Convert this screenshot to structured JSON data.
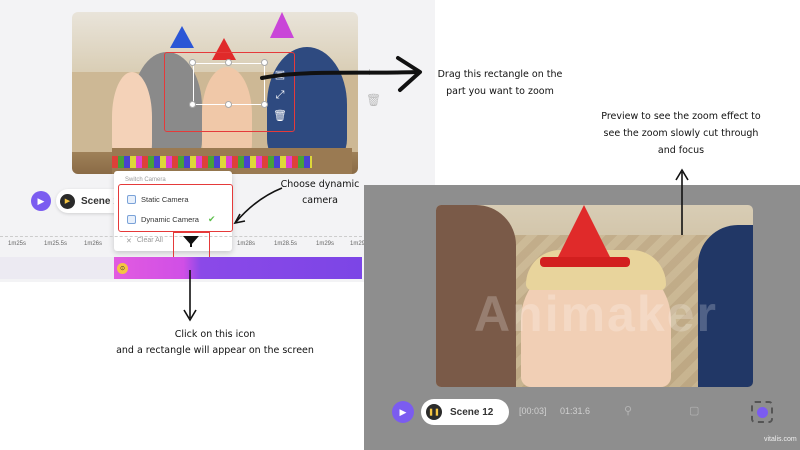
{
  "editor": {
    "scene_label": "Scene 1",
    "dropdown": {
      "title": "Switch Camera",
      "items": [
        {
          "label": "Static Camera",
          "selected": false
        },
        {
          "label": "Dynamic Camera",
          "selected": true
        }
      ],
      "clear_all": "Clear All"
    },
    "timeline_ticks": [
      "1m25s",
      "1m25.5s",
      "1m26s",
      "1m28s",
      "1m28.5s",
      "1m29s",
      "1m29.5s"
    ]
  },
  "preview": {
    "scene_label": "Scene 12",
    "current_time": "[00:03]",
    "total_time": "01:31.6",
    "watermark": "Animaker",
    "site": "vitalis.com"
  },
  "annotations": {
    "drag": [
      "Drag this  rectangle on the",
      "part you want to zoom"
    ],
    "choose": [
      "Choose dynamic",
      "camera"
    ],
    "preview": [
      "Preview to see the zoom effect to",
      "see the zoom slowly cut through",
      "and focus"
    ],
    "click": [
      "Click on this  icon",
      "and a rectangle will appear on the screen"
    ]
  },
  "colors": {
    "accent": "#7b5cf0",
    "highlight": "#e53a3a",
    "track_start": "#e25be0",
    "track_end": "#7c45e6"
  },
  "icons": [
    "play-icon",
    "pause-icon",
    "camera-icon",
    "check-icon",
    "close-icon",
    "down-arrow-icon",
    "delete-icon",
    "resize-icon",
    "expand-icon",
    "user-icon",
    "screen-icon"
  ]
}
